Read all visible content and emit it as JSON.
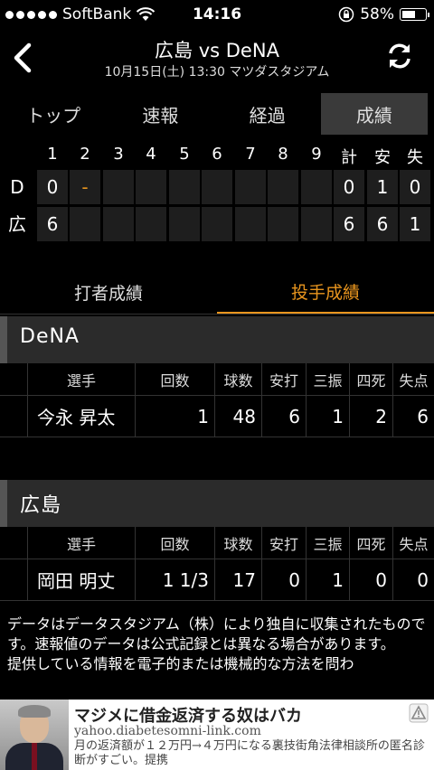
{
  "status": {
    "carrier": "SoftBank",
    "time": "14:16",
    "battery": "58%",
    "battery_level": 0.58
  },
  "header": {
    "title": "広島 vs DeNA",
    "subtitle": "10月15日(土) 13:30 マツダスタジアム"
  },
  "tabs": [
    "トップ",
    "速報",
    "経過",
    "成績"
  ],
  "scoreboard": {
    "columns": [
      "1",
      "2",
      "3",
      "4",
      "5",
      "6",
      "7",
      "8",
      "9",
      "計",
      "安",
      "失"
    ],
    "teams": [
      {
        "abbr": "D",
        "innings": [
          "0",
          "-",
          "",
          "",
          "",
          "",
          "",
          "",
          ""
        ],
        "totals": [
          "0",
          "1",
          "0"
        ]
      },
      {
        "abbr": "広",
        "innings": [
          "6",
          "",
          "",
          "",
          "",
          "",
          "",
          "",
          ""
        ],
        "totals": [
          "6",
          "6",
          "1"
        ]
      }
    ]
  },
  "subtabs": [
    "打者成績",
    "投手成績"
  ],
  "pitching": [
    {
      "team": "DeNA",
      "headers": [
        "選手",
        "回数",
        "球数",
        "安打",
        "三振",
        "四死",
        "失点"
      ],
      "rows": [
        [
          "今永 昇太",
          "1",
          "48",
          "6",
          "1",
          "2",
          "6"
        ]
      ]
    },
    {
      "team": "広島",
      "headers": [
        "選手",
        "回数",
        "球数",
        "安打",
        "三振",
        "四死",
        "失点"
      ],
      "rows": [
        [
          "岡田 明丈",
          "1 1/3",
          "17",
          "0",
          "1",
          "0",
          "0"
        ]
      ]
    }
  ],
  "note": "データはデータスタジアム（株）により独自に収集されたものです。速報値のデータは公式記録とは異なる場合があります。\n提供している情報を電子的または機械的な方法を問わ",
  "ad": {
    "title": "マジメに借金返済する奴はバカ",
    "url": "yahoo.diabetesomni-link.com",
    "desc": "月の返済額が１２万円→４万円になる裏技街角法律相談所の匿名診断がすごい。提携"
  }
}
